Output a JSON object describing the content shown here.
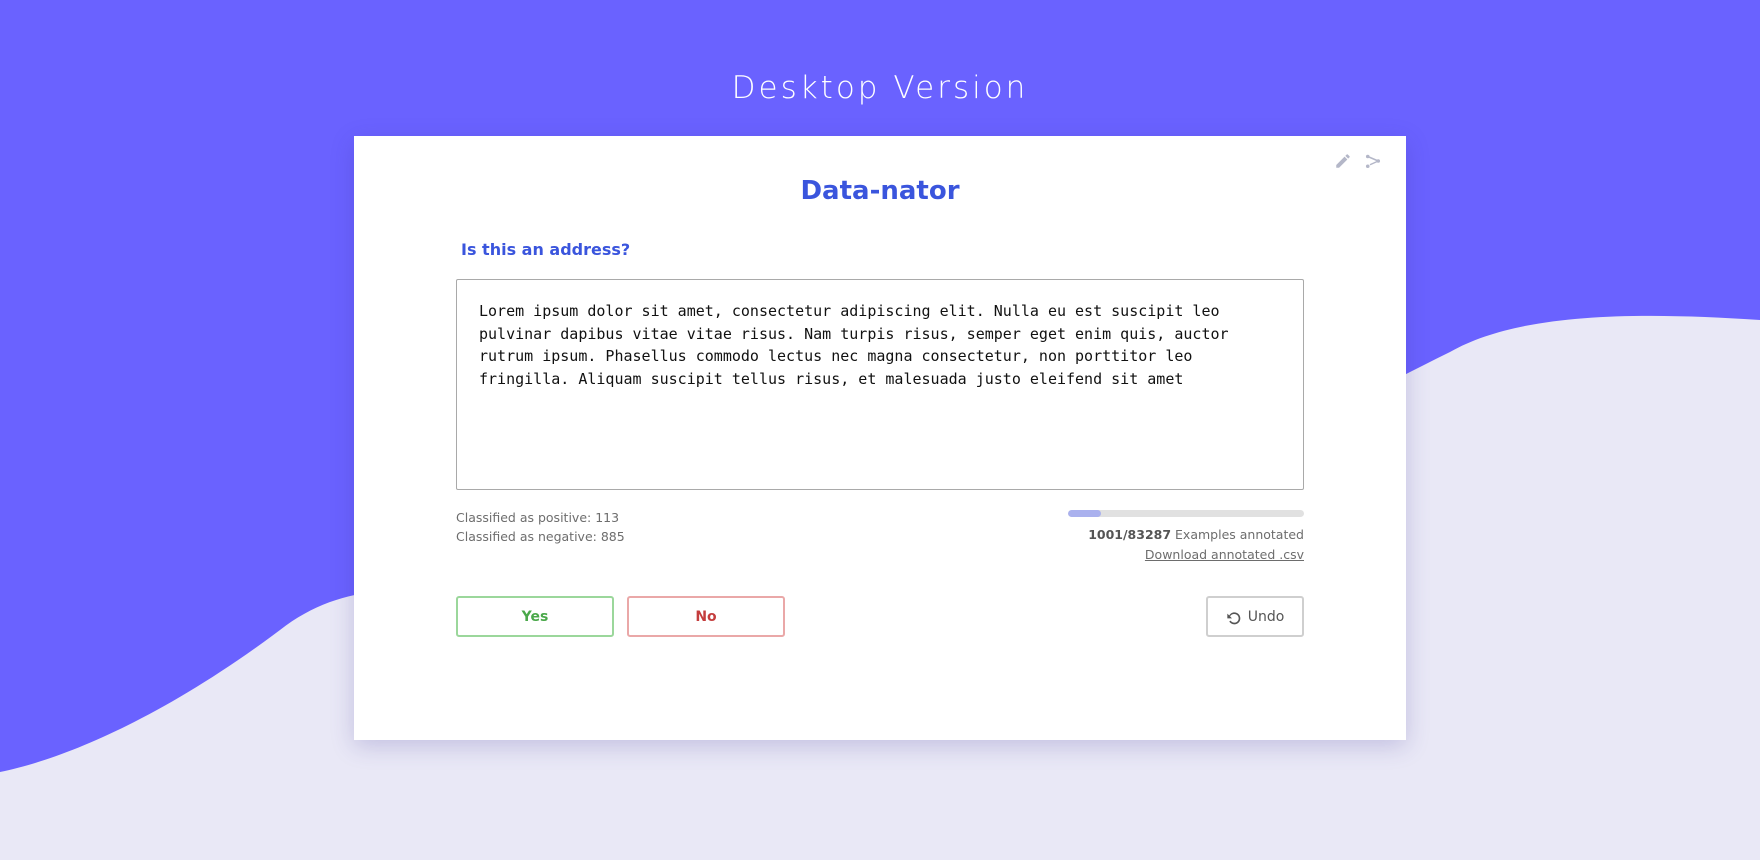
{
  "page": {
    "heading": "Desktop Version"
  },
  "card": {
    "actions": {
      "edit_icon": "pencil-icon",
      "share_icon": "share-icon"
    },
    "title": "Data-nator",
    "question": "Is this an address?",
    "sample_text": "Lorem ipsum dolor sit amet, consectetur adipiscing elit. Nulla eu est suscipit leo pulvinar dapibus vitae vitae risus. Nam turpis risus, semper eget enim quis, auctor rutrum ipsum. Phasellus commodo lectus nec magna consectetur, non porttitor leo fringilla. Aliquam suscipit tellus risus, et malesuada justo eleifend sit amet",
    "stats": {
      "positive": "Classified as positive: 113",
      "negative": "Classified as negative: 885"
    },
    "progress": {
      "count": "1001/83287",
      "label": "Examples annotated",
      "fill_fraction": 0.14,
      "download_label": "Download annotated .csv"
    },
    "buttons": {
      "yes": "Yes",
      "no": "No",
      "undo": "Undo",
      "undo_icon": "undo-icon"
    }
  },
  "colors": {
    "background_wave": "#6a62ff",
    "background_lower": "#e9e8f6",
    "accent": "#3a55dd",
    "yes": "#4aa84a",
    "no": "#c43d3d",
    "progress_fill": "#aab1ee"
  }
}
